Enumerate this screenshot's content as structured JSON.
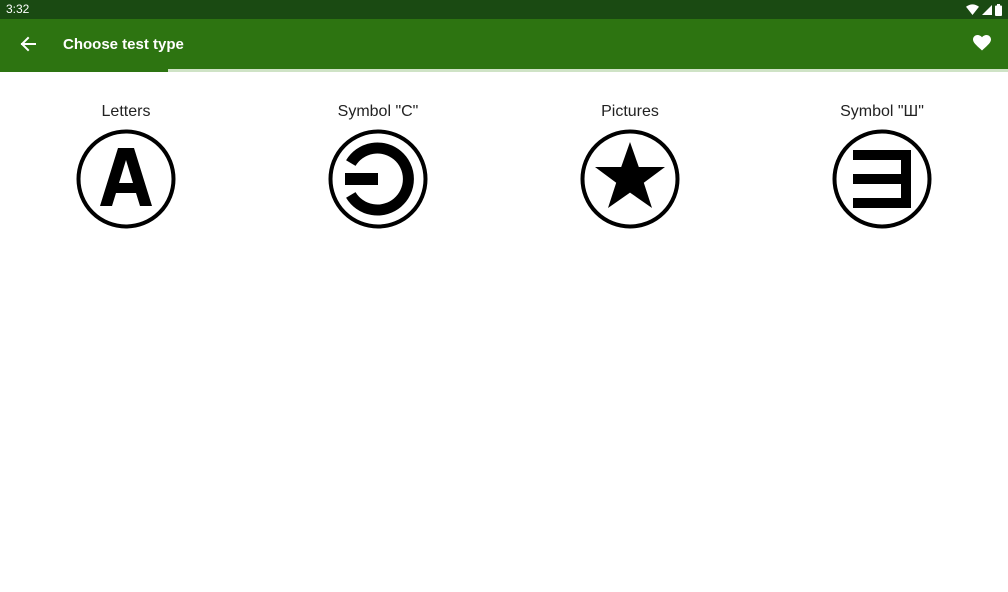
{
  "status_bar": {
    "time": "3:32",
    "icons": [
      "wifi-icon",
      "signal-icon",
      "battery-icon"
    ]
  },
  "app_bar": {
    "title": "Choose test type",
    "back_icon": "arrow-left-icon",
    "favorite_icon": "heart-icon",
    "progress_fraction": 0.167
  },
  "choices": [
    {
      "label": "Letters",
      "icon": "letter-a-icon"
    },
    {
      "label": "Symbol \"C\"",
      "icon": "landolt-c-icon"
    },
    {
      "label": "Pictures",
      "icon": "star-icon"
    },
    {
      "label": "Symbol \"Ш\"",
      "icon": "tumbling-e-icon"
    }
  ],
  "colors": {
    "status_bar": "#1a4a12",
    "app_bar": "#2d7411",
    "progress_track": "#cfe3c6",
    "icon": "#000000",
    "label_text": "#222222"
  }
}
